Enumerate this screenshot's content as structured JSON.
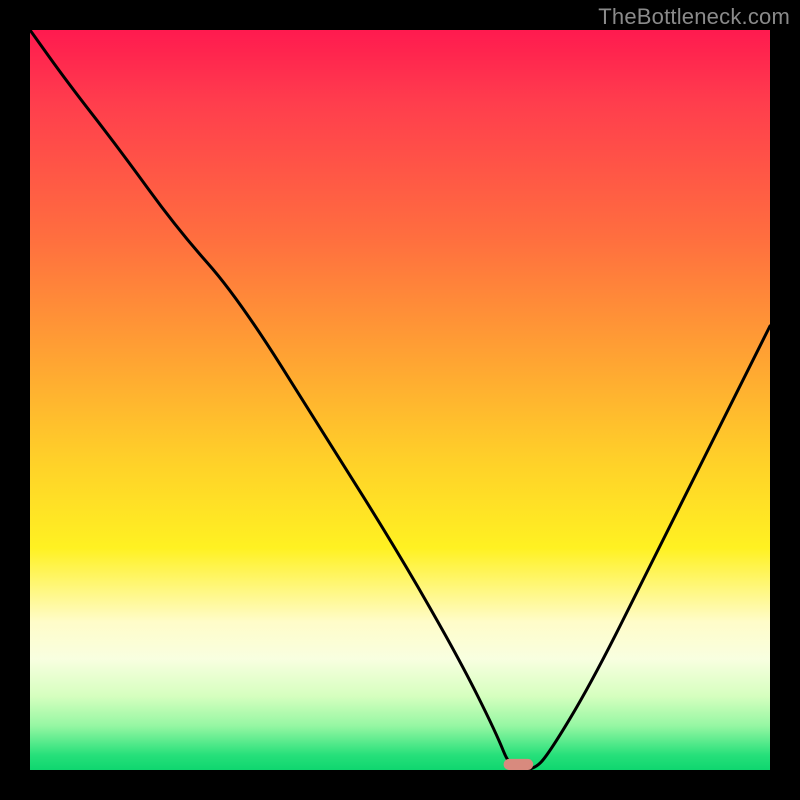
{
  "watermark": "TheBottleneck.com",
  "colors": {
    "curve": "#000000",
    "marker": "#d88a7e",
    "gradient_top": "#ff1a4f",
    "gradient_bottom": "#0fd66f",
    "frame": "#000000"
  },
  "chart_data": {
    "type": "line",
    "title": "",
    "xlabel": "",
    "ylabel": "",
    "xlim": [
      0,
      100
    ],
    "ylim": [
      0,
      100
    ],
    "grid": false,
    "series": [
      {
        "name": "bottleneck-curve",
        "x": [
          0,
          5,
          12,
          20,
          28,
          40,
          50,
          58,
          63,
          65,
          68,
          70,
          76,
          84,
          92,
          100
        ],
        "values": [
          100,
          93,
          84,
          73,
          64,
          45,
          29,
          15,
          5,
          0,
          0,
          2,
          12,
          28,
          44,
          60
        ]
      }
    ],
    "marker": {
      "name": "optimal-point",
      "x": 66,
      "y": 0,
      "width": 4,
      "height": 1.5,
      "shape": "pill"
    }
  }
}
